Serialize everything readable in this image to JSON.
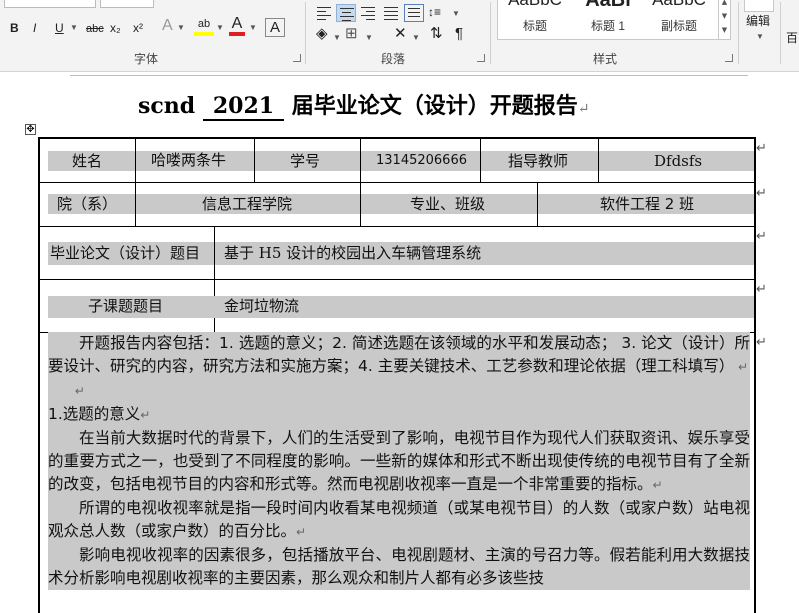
{
  "ribbon": {
    "font_group": {
      "label": "字体",
      "buttons": [
        "B",
        "I",
        "U",
        "abc",
        "x₂",
        "x²",
        "A",
        "ab",
        "A",
        "A"
      ]
    },
    "paragraph_group": {
      "label": "段落"
    },
    "styles_group": {
      "label": "样式",
      "styles": [
        {
          "sample": "AaBbC",
          "name": "标题"
        },
        {
          "sample": "AaBl",
          "name": "标题 1"
        },
        {
          "sample": "AaBbC",
          "name": "副标题"
        }
      ]
    },
    "editing": {
      "label": "编辑",
      "cut_label": "百"
    }
  },
  "document": {
    "title": {
      "prefix": "scnd",
      "year": "2021",
      "suffix": "届毕业论文（设计）开题报告"
    },
    "table": {
      "row1": {
        "name_label": "姓名",
        "name_value": "哈喽两条牛",
        "id_label": "学号",
        "id_value": "13145206666",
        "advisor_label": "指导教师",
        "advisor_value": "Dfdsfs"
      },
      "row2": {
        "dept_label": "院（系）",
        "dept_value": "信息工程学院",
        "major_label": "专业、班级",
        "major_value": "软件工程 2 班"
      },
      "row3": {
        "topic_label": "毕业论文（设计）题目",
        "topic_value": "基于 H5 设计的校园出入车辆管理系统"
      },
      "row4": {
        "subtopic_label": "子课题题目",
        "subtopic_value": "金坷垃物流"
      }
    },
    "body": {
      "intro": "开题报告内容包括：1. 选题的意义；2. 简述选题在该领域的水平和发展动态； 3. 论文（设计）所要设计、研究的内容，研究方法和实施方案；4. 主要关键技术、工艺参数和理论依据（理工科填写）",
      "heading1": "1.选题的意义",
      "p1": "在当前大数据时代的背景下，人们的生活受到了影响，电视节目作为现代人们获取资讯、娱乐享受的重要方式之一，也受到了不同程度的影响。一些新的媒体和形式不断出现使传统的电视节目有了全新的改变，包括电视节目的内容和形式等。然而电视剧收视率一直是一个非常重要的指标。",
      "p2": "所谓的电视收视率就是指一段时间内收看某电视频道（或某电视节目）的人数（或家户数）站电视观众总人数（或家户数）的百分比。",
      "p3": "影响电视收视率的因素很多，包括播放平台、电视剧题材、主演的号召力等。假若能利用大数据技术分析影响电视剧收视率的主要因素，那么观众和制片人都有必多该些技"
    }
  }
}
